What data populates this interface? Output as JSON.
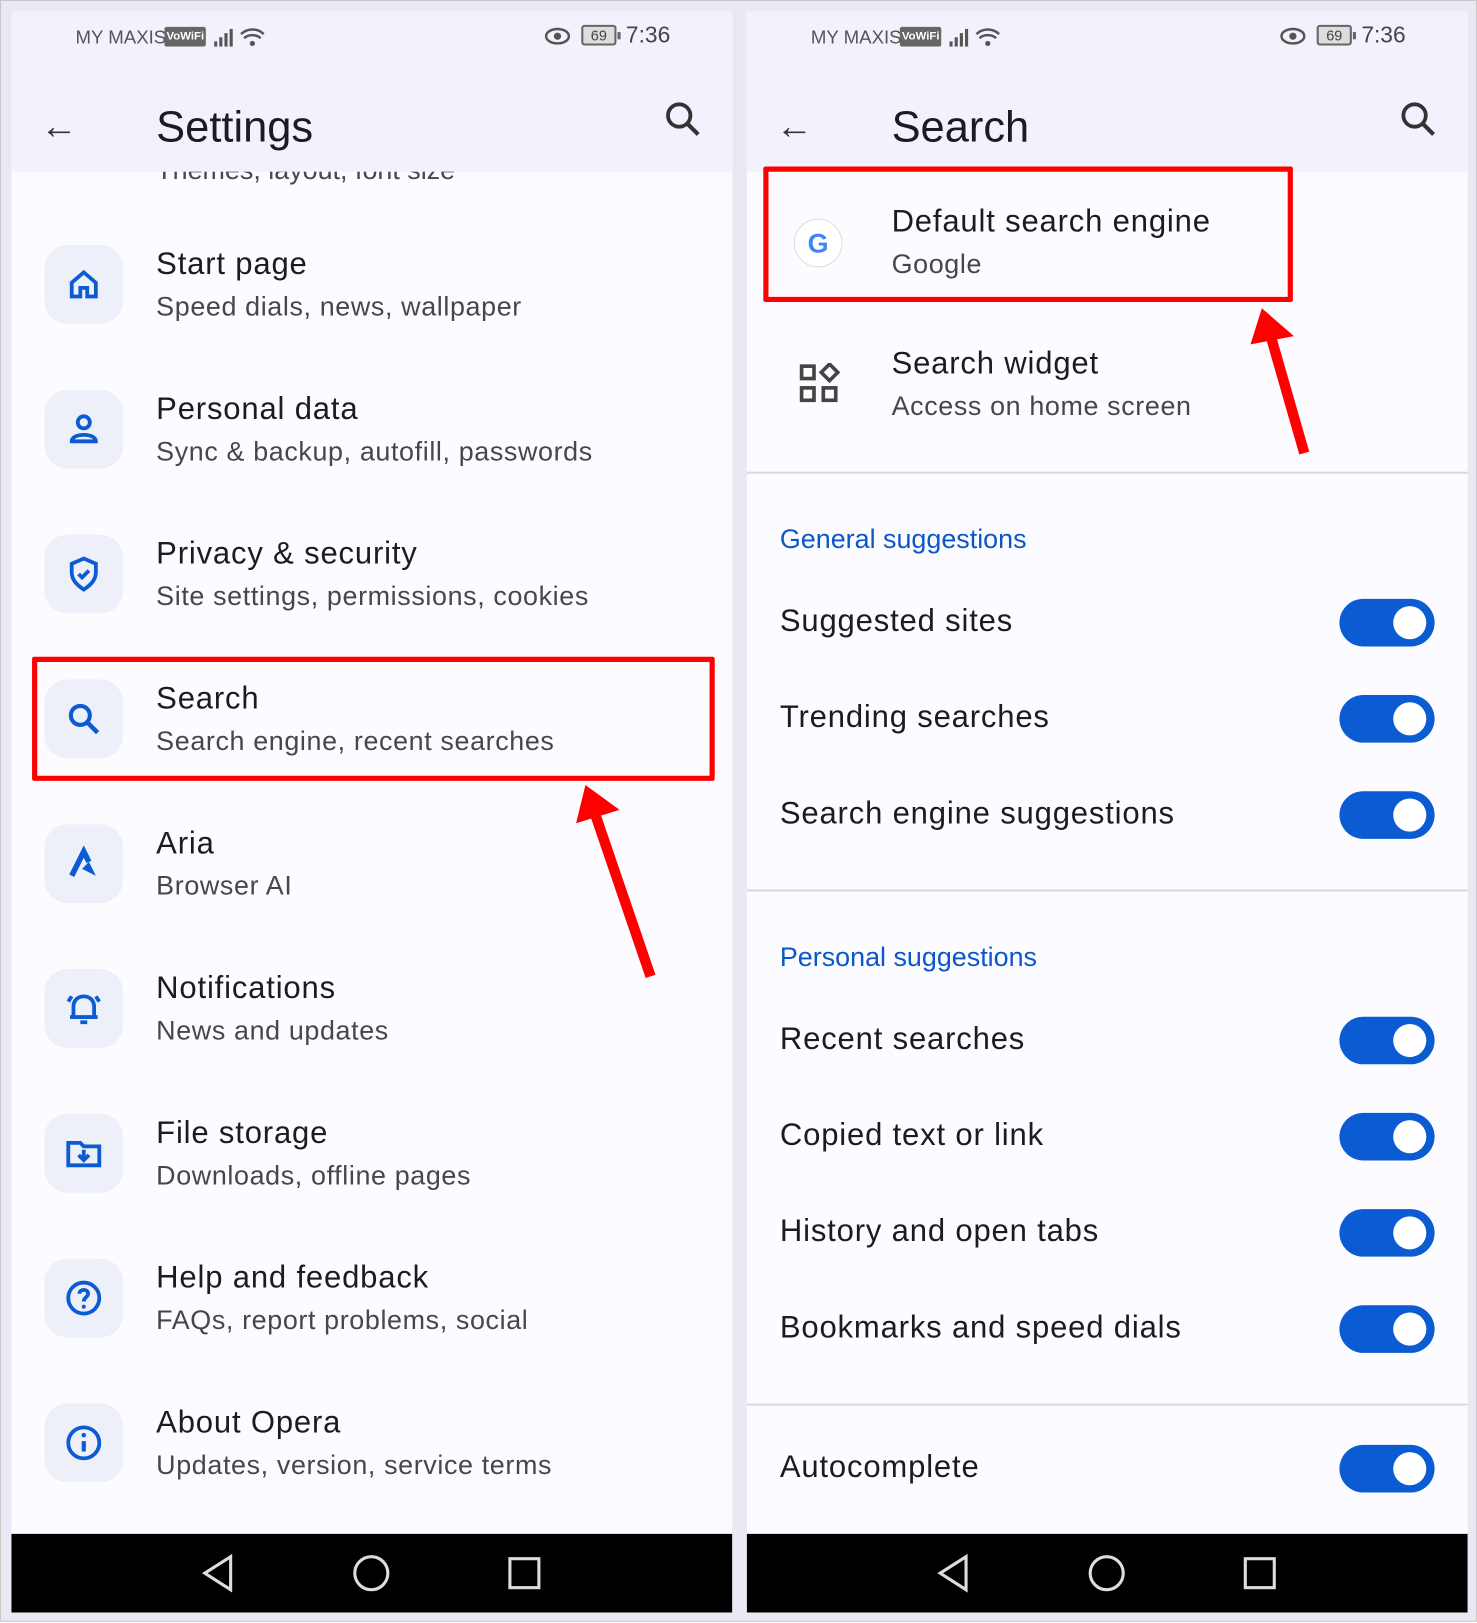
{
  "status_bar": {
    "carrier": "MY MAXIS",
    "vowifi": "VoWiFi",
    "battery": "69",
    "time": "7:36"
  },
  "left": {
    "title": "Settings",
    "partial_subtitle": "Themes, layout, font size",
    "items": [
      {
        "title": "Start page",
        "subtitle": "Speed dials, news, wallpaper",
        "icon": "home-icon"
      },
      {
        "title": "Personal data",
        "subtitle": "Sync & backup, autofill, passwords",
        "icon": "person-icon"
      },
      {
        "title": "Privacy & security",
        "subtitle": "Site settings, permissions, cookies",
        "icon": "shield-icon"
      },
      {
        "title": "Search",
        "subtitle": "Search engine, recent searches",
        "icon": "search-icon"
      },
      {
        "title": "Aria",
        "subtitle": "Browser AI",
        "icon": "aria-icon"
      },
      {
        "title": "Notifications",
        "subtitle": "News and updates",
        "icon": "bell-icon"
      },
      {
        "title": "File storage",
        "subtitle": "Downloads, offline pages",
        "icon": "folder-download-icon"
      },
      {
        "title": "Help and feedback",
        "subtitle": "FAQs, report problems, social",
        "icon": "help-icon"
      },
      {
        "title": "About Opera",
        "subtitle": "Updates, version, service terms",
        "icon": "info-icon"
      }
    ]
  },
  "right": {
    "title": "Search",
    "default_engine": {
      "title": "Default search engine",
      "value": "Google"
    },
    "widget": {
      "title": "Search widget",
      "subtitle": "Access on home screen"
    },
    "general": {
      "header": "General suggestions",
      "toggles": [
        {
          "label": "Suggested sites",
          "on": true
        },
        {
          "label": "Trending searches",
          "on": true
        },
        {
          "label": "Search engine suggestions",
          "on": true
        }
      ]
    },
    "personal": {
      "header": "Personal suggestions",
      "toggles": [
        {
          "label": "Recent searches",
          "on": true
        },
        {
          "label": "Copied text or link",
          "on": true
        },
        {
          "label": "History and open tabs",
          "on": true
        },
        {
          "label": "Bookmarks and speed dials",
          "on": true
        }
      ]
    },
    "autocomplete": {
      "label": "Autocomplete",
      "on": true
    }
  },
  "colors": {
    "accent": "#0b5bd3",
    "highlight": "#ff0000"
  }
}
